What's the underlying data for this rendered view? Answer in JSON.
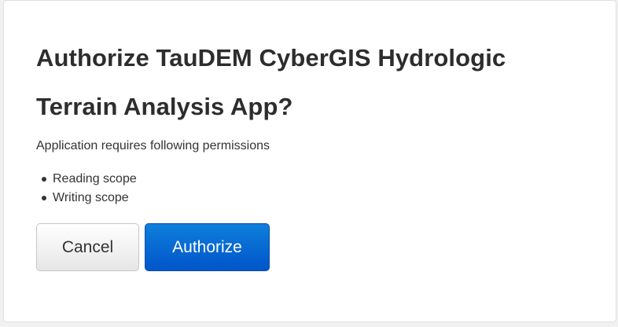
{
  "dialog": {
    "title": "Authorize TauDEM CyberGIS Hydrologic Terrain Analysis App?",
    "intro": "Application requires following permissions",
    "permissions": [
      "Reading scope",
      "Writing scope"
    ],
    "buttons": {
      "cancel_label": "Cancel",
      "authorize_label": "Authorize"
    }
  },
  "colors": {
    "primary_button": "#0066cc",
    "secondary_button": "#eeeeee",
    "title_text": "#2d2d2d"
  }
}
